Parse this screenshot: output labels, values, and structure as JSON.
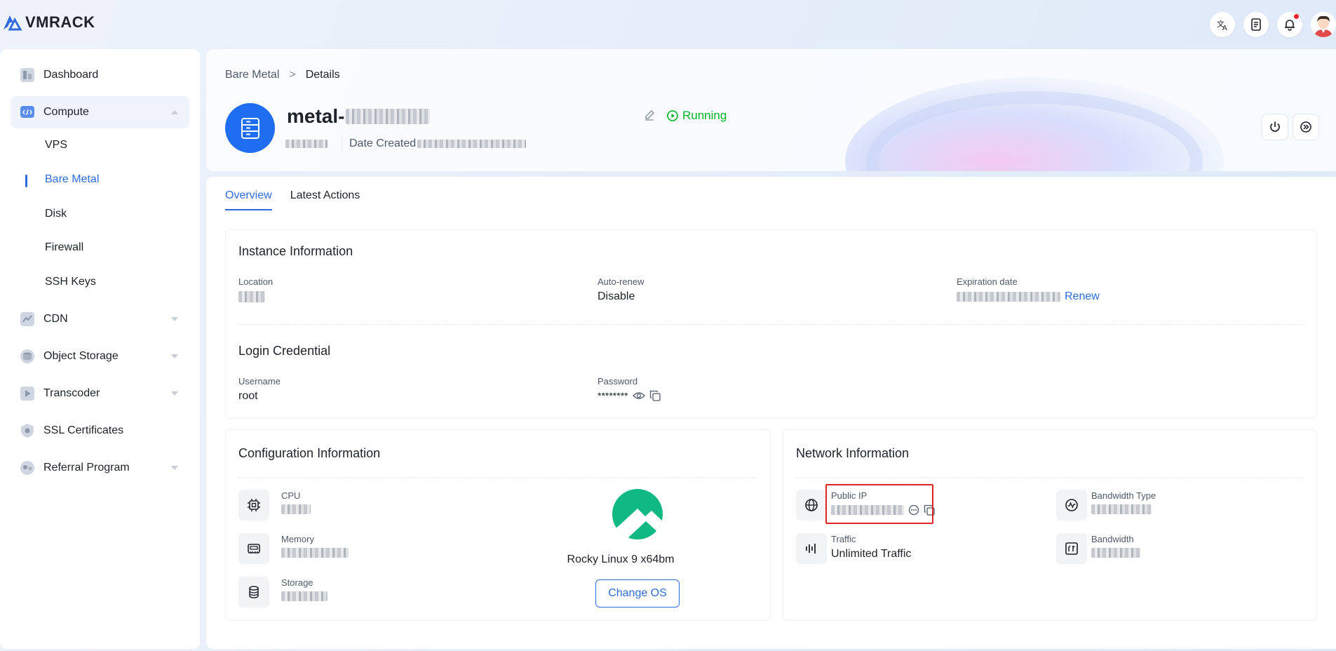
{
  "brand": {
    "name": "VMRACK"
  },
  "topbar": {
    "icons": [
      "translate-icon",
      "document-icon",
      "bell-icon",
      "avatar"
    ]
  },
  "sidebar": {
    "items": [
      {
        "label": "Dashboard",
        "icon": "dashboard-icon"
      },
      {
        "label": "Compute",
        "icon": "compute-icon",
        "expanded": true,
        "children": [
          {
            "label": "VPS"
          },
          {
            "label": "Bare Metal",
            "active": true
          },
          {
            "label": "Disk"
          },
          {
            "label": "Firewall"
          },
          {
            "label": "SSH Keys"
          }
        ]
      },
      {
        "label": "CDN",
        "icon": "cdn-icon"
      },
      {
        "label": "Object Storage",
        "icon": "object-storage-icon"
      },
      {
        "label": "Transcoder",
        "icon": "transcoder-icon"
      },
      {
        "label": "SSL Certificates",
        "icon": "ssl-icon"
      },
      {
        "label": "Referral Program",
        "icon": "referral-icon"
      }
    ]
  },
  "breadcrumb": {
    "parent": "Bare Metal",
    "sep": ">",
    "current": "Details"
  },
  "instance": {
    "name_prefix": "metal-",
    "status": "Running",
    "status_color": "#00b42a",
    "date_created_label": "Date Created"
  },
  "tabs": [
    {
      "label": "Overview",
      "active": true
    },
    {
      "label": "Latest Actions"
    }
  ],
  "instance_info": {
    "title": "Instance Information",
    "location_label": "Location",
    "autorenew_label": "Auto-renew",
    "autorenew_value": "Disable",
    "expiration_label": "Expiration date",
    "renew_link": "Renew"
  },
  "login": {
    "title": "Login Credential",
    "username_label": "Username",
    "username_value": "root",
    "password_label": "Password",
    "password_value": "********"
  },
  "config": {
    "title": "Configuration Information",
    "cpu_label": "CPU",
    "memory_label": "Memory",
    "storage_label": "Storage",
    "os_name": "Rocky Linux 9 x64bm",
    "change_os": "Change OS"
  },
  "network": {
    "title": "Network Information",
    "public_ip_label": "Public IP",
    "bandwidth_type_label": "Bandwidth Type",
    "traffic_label": "Traffic",
    "traffic_value": "Unlimited Traffic",
    "bandwidth_label": "Bandwidth"
  },
  "colors": {
    "accent": "#2f6bdb",
    "server_icon_bg": "#1f6df1",
    "os_logo": "#10b981",
    "highlight": "#e02424"
  }
}
